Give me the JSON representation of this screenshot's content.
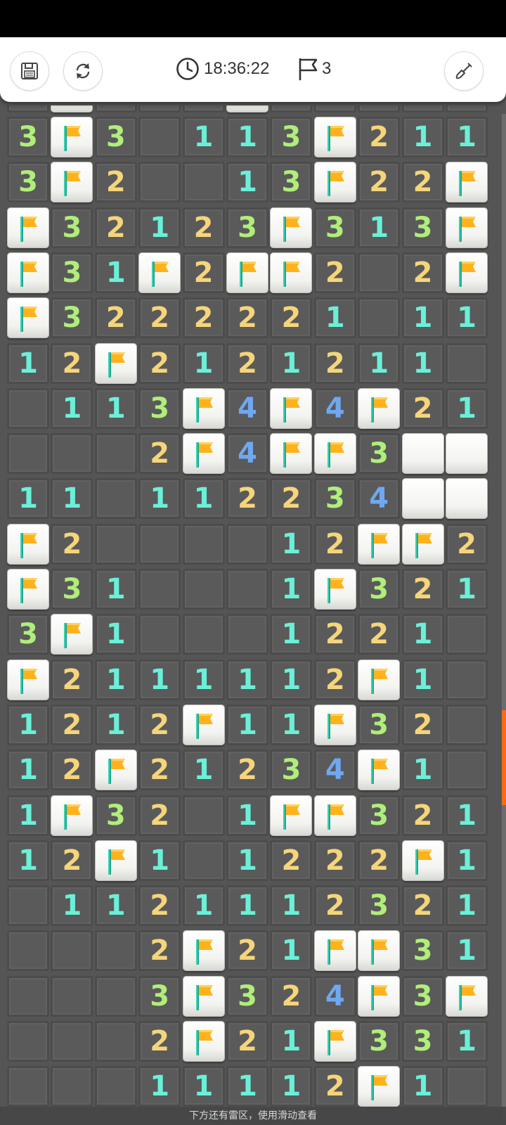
{
  "header": {
    "timer": "18:36:22",
    "flags_remaining": "3"
  },
  "hint_text": "下方还有雷区，使用滑动查看",
  "colors": {
    "one": "#6af0d8",
    "two": "#f6d57a",
    "three": "#b0ee7a",
    "four": "#6fa8f0",
    "scroll_thumb": "#ff6a13"
  },
  "icons": [
    "save-icon",
    "refresh-icon",
    "clock-icon",
    "flag-icon",
    "shovel-icon"
  ],
  "board": {
    "legend": "number = revealed count, F = flag, E = revealed empty, H = unrevealed tile",
    "rows": [
      [
        "3",
        "F",
        "3",
        "E",
        "1",
        "1",
        "3",
        "F",
        "2",
        "1",
        "1"
      ],
      [
        "3",
        "F",
        "2",
        "E",
        "E",
        "1",
        "3",
        "F",
        "2",
        "2",
        "F"
      ],
      [
        "F",
        "3",
        "2",
        "1",
        "2",
        "3",
        "F",
        "3",
        "1",
        "3",
        "F"
      ],
      [
        "F",
        "3",
        "1",
        "F",
        "2",
        "F",
        "F",
        "2",
        "E",
        "2",
        "F"
      ],
      [
        "F",
        "3",
        "2",
        "2",
        "2",
        "2",
        "2",
        "1",
        "E",
        "1",
        "1"
      ],
      [
        "1",
        "2",
        "F",
        "2",
        "1",
        "2",
        "1",
        "2",
        "1",
        "1",
        "E"
      ],
      [
        "E",
        "1",
        "1",
        "3",
        "F",
        "4",
        "F",
        "4",
        "F",
        "2",
        "1"
      ],
      [
        "E",
        "E",
        "E",
        "2",
        "F",
        "4",
        "F",
        "F",
        "3",
        "H",
        "H"
      ],
      [
        "1",
        "1",
        "E",
        "1",
        "1",
        "2",
        "2",
        "3",
        "4",
        "H",
        "H"
      ],
      [
        "F",
        "2",
        "E",
        "E",
        "E",
        "E",
        "1",
        "2",
        "F",
        "F",
        "2"
      ],
      [
        "F",
        "3",
        "1",
        "E",
        "E",
        "E",
        "1",
        "F",
        "3",
        "2",
        "1"
      ],
      [
        "3",
        "F",
        "1",
        "E",
        "E",
        "E",
        "1",
        "2",
        "2",
        "1",
        "E"
      ],
      [
        "F",
        "2",
        "1",
        "1",
        "1",
        "1",
        "1",
        "2",
        "F",
        "1",
        "E"
      ],
      [
        "1",
        "2",
        "1",
        "2",
        "F",
        "1",
        "1",
        "F",
        "3",
        "2",
        "E"
      ],
      [
        "1",
        "2",
        "F",
        "2",
        "1",
        "2",
        "3",
        "4",
        "F",
        "1",
        "E"
      ],
      [
        "1",
        "F",
        "3",
        "2",
        "E",
        "1",
        "F",
        "F",
        "3",
        "2",
        "1"
      ],
      [
        "1",
        "2",
        "F",
        "1",
        "E",
        "1",
        "2",
        "2",
        "2",
        "F",
        "1"
      ],
      [
        "E",
        "1",
        "1",
        "2",
        "1",
        "1",
        "1",
        "2",
        "3",
        "2",
        "1"
      ],
      [
        "E",
        "E",
        "E",
        "2",
        "F",
        "2",
        "1",
        "F",
        "F",
        "3",
        "1"
      ],
      [
        "E",
        "E",
        "E",
        "3",
        "F",
        "3",
        "2",
        "4",
        "F",
        "3",
        "F"
      ],
      [
        "E",
        "E",
        "E",
        "2",
        "F",
        "2",
        "1",
        "F",
        "3",
        "3",
        "1"
      ],
      [
        "E",
        "E",
        "E",
        "1",
        "1",
        "1",
        "1",
        "2",
        "F",
        "1",
        "E"
      ]
    ]
  }
}
